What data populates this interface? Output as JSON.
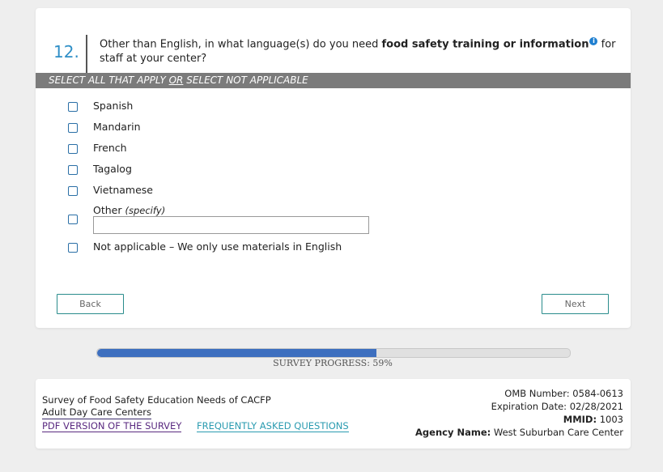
{
  "question": {
    "number": "12.",
    "text_before": "Other than English, in what language(s) do you need ",
    "text_bold": "food safety training or information",
    "info_icon": "i",
    "text_after": " for staff at your center?"
  },
  "instruction": {
    "part1": "SELECT ALL THAT APPLY ",
    "part2": "OR",
    "part3": " SELECT NOT APPLICABLE"
  },
  "options": [
    {
      "label": "Spanish"
    },
    {
      "label": "Mandarin"
    },
    {
      "label": "French"
    },
    {
      "label": "Tagalog"
    },
    {
      "label": "Vietnamese"
    },
    {
      "label": "Other ",
      "italic": "(specify)"
    },
    {
      "label": "Not applicable – We only use materials in English"
    }
  ],
  "other_input": {
    "value": "",
    "placeholder": ""
  },
  "nav": {
    "back_label": "Back",
    "next_label": "Next"
  },
  "progress": {
    "percent": 59,
    "label": "SURVEY PROGRESS: 59%"
  },
  "footer": {
    "title_line1": "Survey of Food Safety Education Needs of CACFP",
    "title_line2": "Adult Day Care Centers",
    "pdf_link": "PDF VERSION OF THE SURVEY",
    "faq_link": "FREQUENTLY ASKED QUESTIONS",
    "omb": "OMB Number: 0584-0613",
    "expiration": "Expiration Date: 02/28/2021",
    "mmid_label": "MMID:",
    "mmid_value": " 1003",
    "agency_label": "Agency Name:",
    "agency_value": " West Suburban Care Center"
  },
  "colors": {
    "accent": "#2f8fc7",
    "progress": "#3d6fbf",
    "instruction_bar": "#7b7b7b",
    "button_border": "#2a8c8c"
  }
}
